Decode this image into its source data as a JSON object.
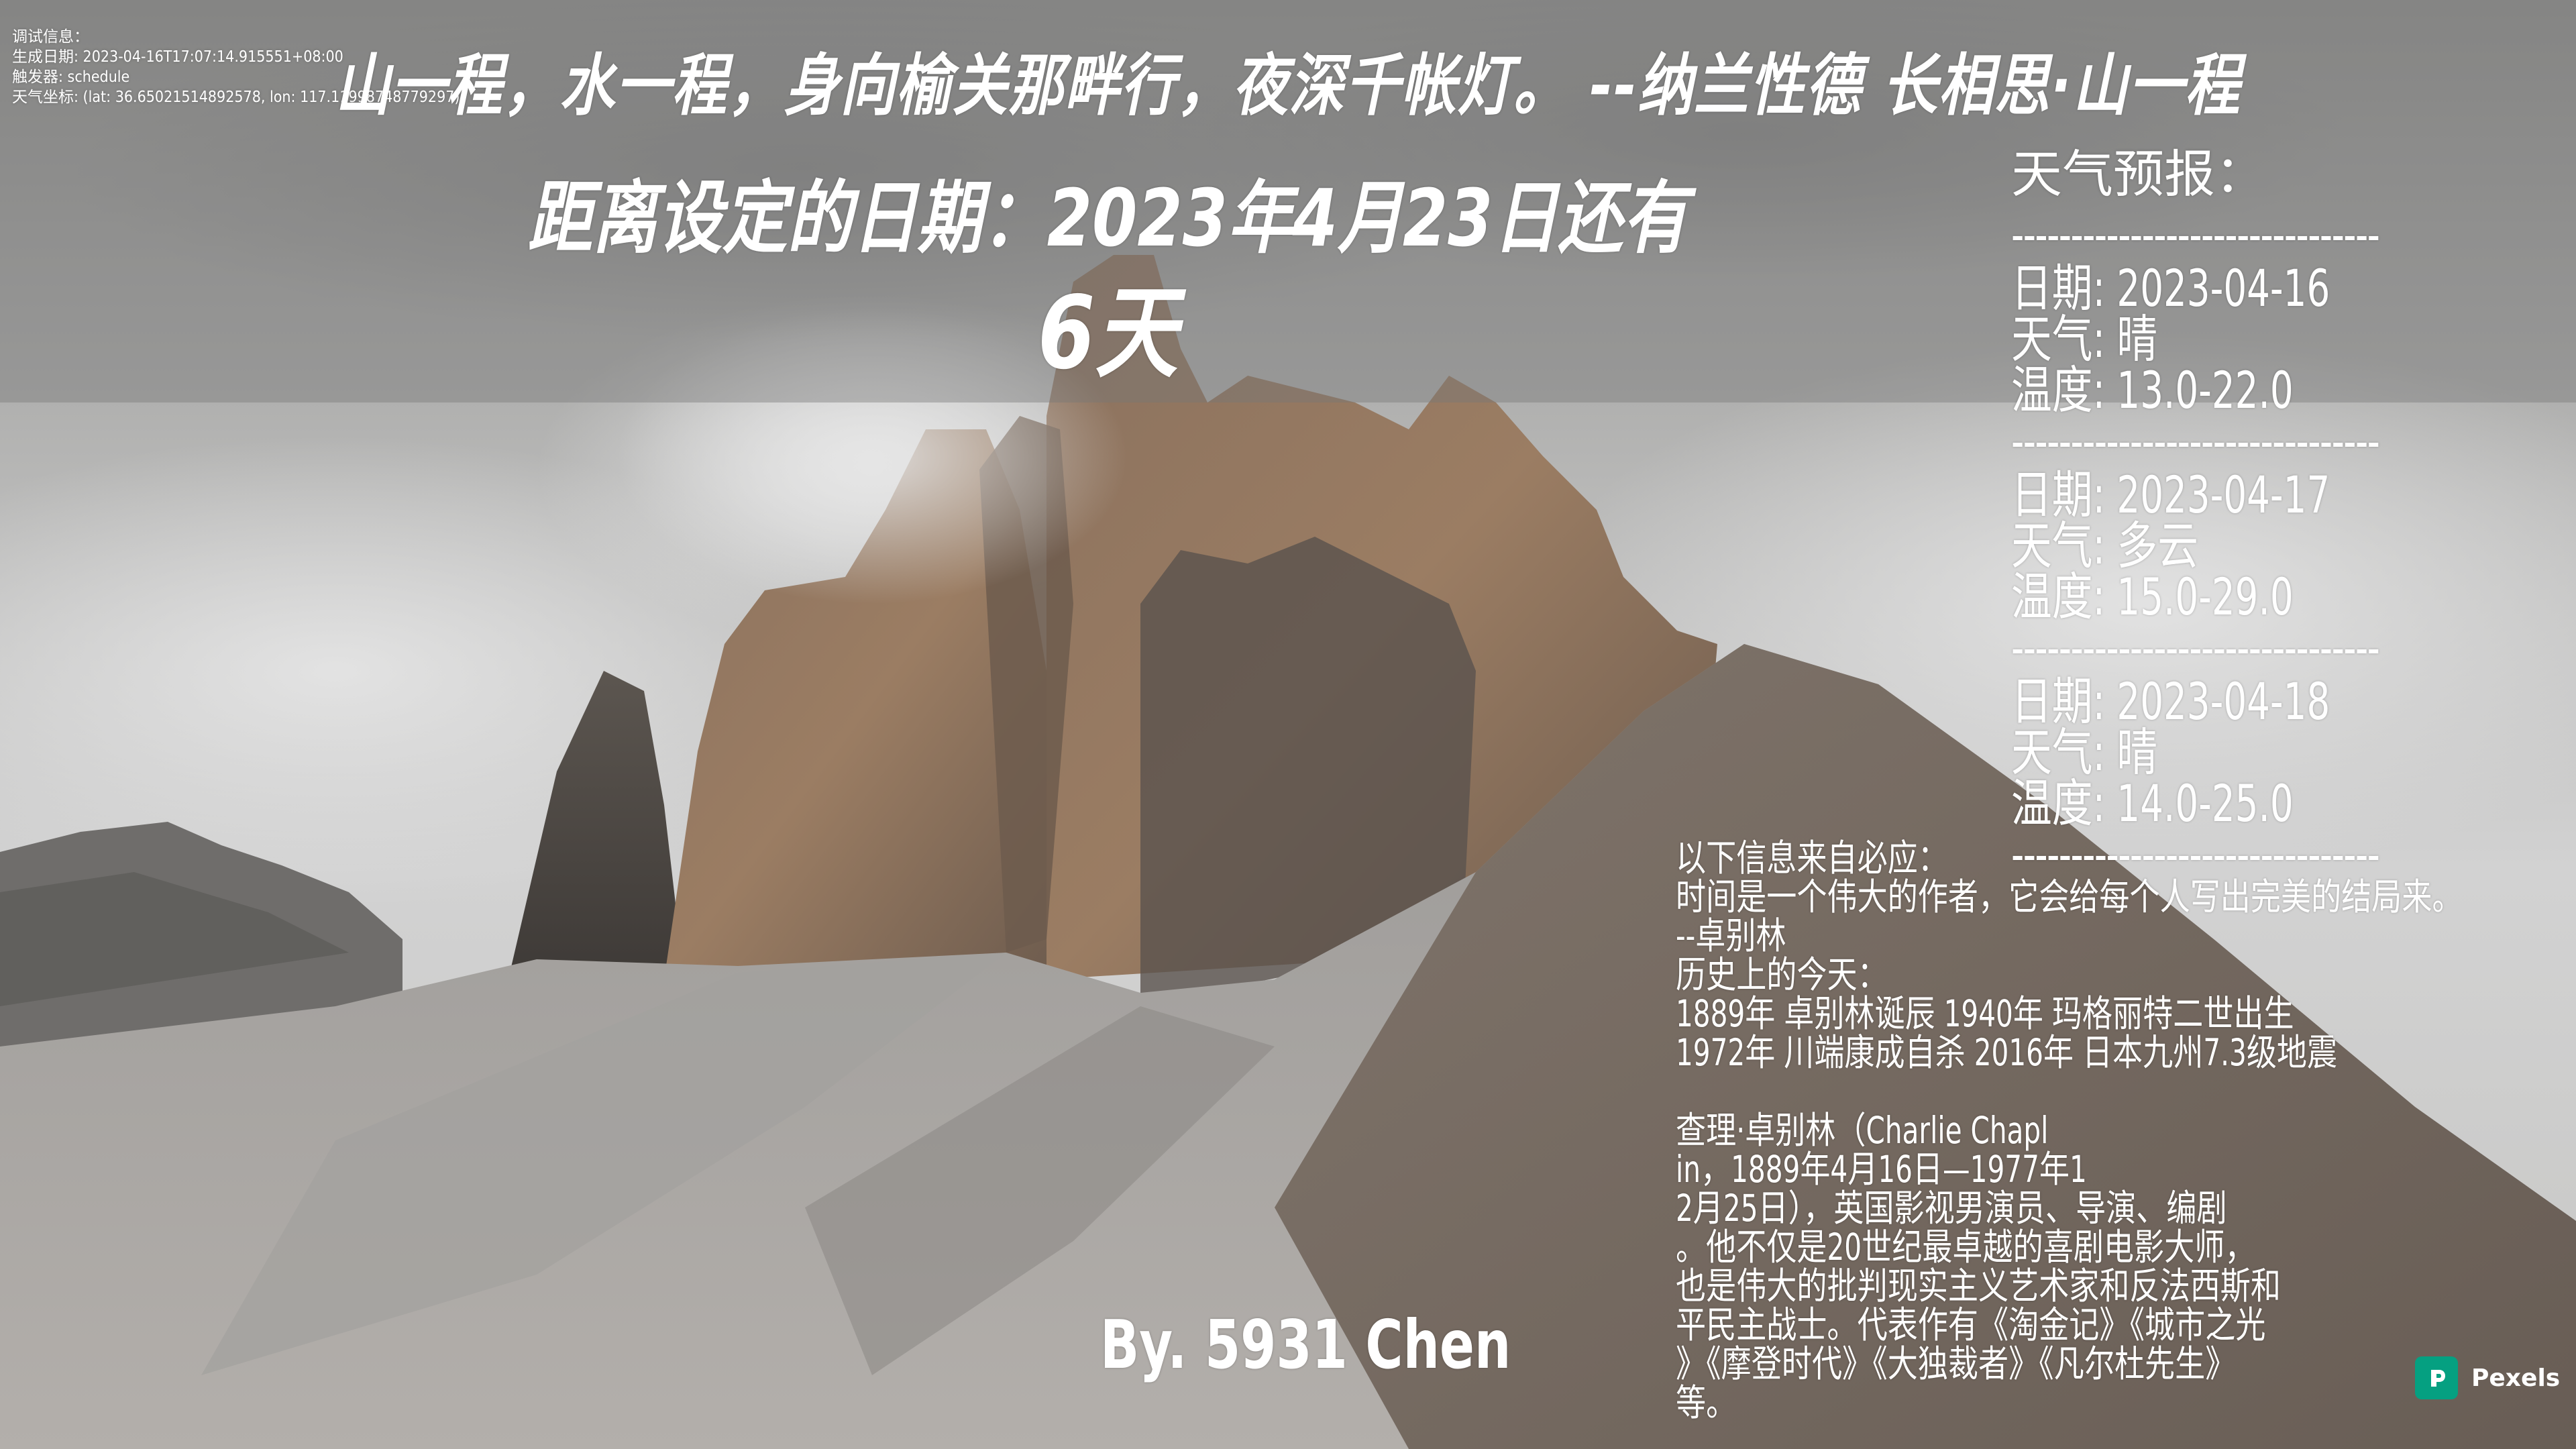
{
  "debug": {
    "lines": [
      "调试信息：",
      "生成日期: 2023-04-16T17:07:14.915551+08:00",
      "触发器: schedule",
      "天气坐标: (lat: 36.65021514892578, lon: 117.11998748779297)"
    ]
  },
  "quote": "山一程，水一程，身向榆关那畔行，夜深千帐灯。 --纳兰性德 长相思·山一程",
  "countdown": {
    "label": "距离设定的日期：2023年4月23日还有",
    "value": "6天"
  },
  "weather": {
    "title": "天气预报：",
    "separator": "-------------------------------",
    "days": [
      {
        "date": "日期: 2023-04-16",
        "weather": "天气: 晴",
        "temp": "温度: 13.0-22.0"
      },
      {
        "date": "日期: 2023-04-17",
        "weather": "天气: 多云",
        "temp": "温度: 15.0-29.0"
      },
      {
        "date": "日期: 2023-04-18",
        "weather": "天气: 晴",
        "temp": "温度: 14.0-25.0"
      }
    ]
  },
  "news": {
    "lines": [
      "以下信息来自必应：",
      "时间是一个伟大的作者，它会给每个人写出完美的结局来。",
      "--卓别林",
      "历史上的今天：",
      "1889年 卓别林诞辰  1940年 玛格丽特二世出生",
      "1972年 川端康成自杀  2016年 日本九州7.3级地震",
      "",
      "查理·卓别林（Charlie Chapl",
      "in，1889年4月16日—1977年1",
      "2月25日），英国影视男演员、导演、编剧",
      "。他不仅是20世纪最卓越的喜剧电影大师，",
      "也是伟大的批判现实主义艺术家和反法西斯和",
      "平民主战士。代表作有《淘金记》《城市之光",
      "》《摩登时代》《大独裁者》《凡尔杜先生》",
      "等。"
    ]
  },
  "signature": "By. 5931 Chen",
  "watermark": {
    "label": "Pexels",
    "color": "#05a081"
  }
}
